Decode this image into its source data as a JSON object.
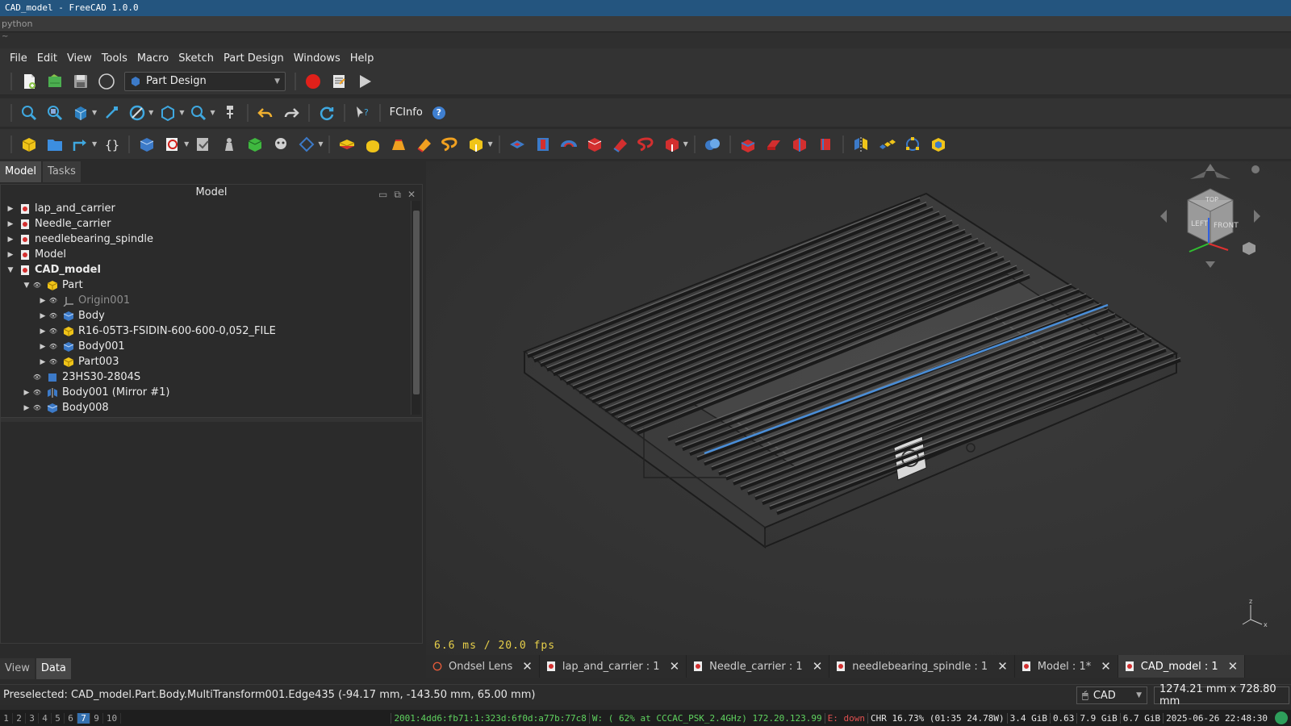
{
  "window": {
    "title": "CAD_model - FreeCAD 1.0.0"
  },
  "python_bar": {
    "label": "python",
    "tilde": "~"
  },
  "menu": [
    "File",
    "Edit",
    "View",
    "Tools",
    "Macro",
    "Sketch",
    "Part Design",
    "Windows",
    "Help"
  ],
  "toolbar": {
    "workbench": "Part Design",
    "fcinfo": "FCInfo",
    "help": "?"
  },
  "left_tabs": {
    "model": "Model",
    "tasks": "Tasks"
  },
  "panel": {
    "title": "Model"
  },
  "tree": [
    {
      "label": "lap_and_carrier",
      "level": 0,
      "expander": "▶",
      "icon": "document-icon"
    },
    {
      "label": "Needle_carrier",
      "level": 0,
      "expander": "▶",
      "icon": "document-icon"
    },
    {
      "label": "needlebearing_spindle",
      "level": 0,
      "expander": "▶",
      "icon": "document-icon"
    },
    {
      "label": "Model",
      "level": 0,
      "expander": "▶",
      "icon": "document-icon"
    },
    {
      "label": "CAD_model",
      "level": 0,
      "expander": "▼",
      "icon": "document-icon",
      "bold": true
    },
    {
      "label": "Part",
      "level": 1,
      "expander": "▼",
      "icon": "part-icon"
    },
    {
      "label": "Origin001",
      "level": 2,
      "expander": "▶",
      "icon": "origin-icon",
      "dim": true
    },
    {
      "label": "Body",
      "level": 2,
      "expander": "▶",
      "icon": "body-icon"
    },
    {
      "label": "R16-05T3-FSIDIN-600-600-0,052_FILE",
      "level": 2,
      "expander": "▶",
      "icon": "part-icon"
    },
    {
      "label": "Body001",
      "level": 2,
      "expander": "▶",
      "icon": "body-icon"
    },
    {
      "label": "Part003",
      "level": 2,
      "expander": "▶",
      "icon": "part-icon"
    },
    {
      "label": "23HS30-2804S",
      "level": 1,
      "expander": "",
      "icon": "solid-icon"
    },
    {
      "label": "Body001 (Mirror #1)",
      "level": 1,
      "expander": "▶",
      "icon": "mirror-icon"
    },
    {
      "label": "Body008",
      "level": 1,
      "expander": "▶",
      "icon": "body-icon"
    }
  ],
  "bottom_tabs": {
    "view": "View",
    "data": "Data"
  },
  "viewport": {
    "fps": "6.6 ms / 20.0 fps"
  },
  "doc_tabs": [
    {
      "label": "Ondsel Lens",
      "active": false
    },
    {
      "label": "lap_and_carrier : 1",
      "active": false
    },
    {
      "label": "Needle_carrier : 1",
      "active": false
    },
    {
      "label": "needlebearing_spindle : 1",
      "active": false
    },
    {
      "label": "Model : 1*",
      "active": false
    },
    {
      "label": "CAD_model : 1",
      "active": true
    }
  ],
  "status": {
    "preselected": "Preselected: CAD_model.Part.Body.MultiTransform001.Edge435 (-94.17 mm, -143.50 mm, 65.00 mm)",
    "nav_style": "CAD",
    "dimensions": "1274.21 mm x 728.80 mm"
  },
  "tray": {
    "workspaces": [
      "1",
      "2",
      "3",
      "4",
      "5",
      "6",
      "7",
      "9",
      "10"
    ],
    "active_workspace": "7",
    "ipv6": "2001:4dd6:fb71:1:323d:6f0d:a77b:77c8",
    "wifi": "W: ( 62% at CCCAC_PSK_2.4GHz) 172.20.123.99",
    "eth": "E: down",
    "battery": "CHR 16.73% (01:35 24.78W)",
    "disk": "3.4 GiB",
    "load": "0.63",
    "mem": "7.9 GiB",
    "swap": "6.7 GiB",
    "datetime": "2025-06-26 22:48:30"
  },
  "colors": {
    "titlebar": "#24557f",
    "fps": "#e8d04a",
    "tray_green": "#5fd35f",
    "tray_red": "#e05050",
    "active_ws": "#3571b0"
  }
}
